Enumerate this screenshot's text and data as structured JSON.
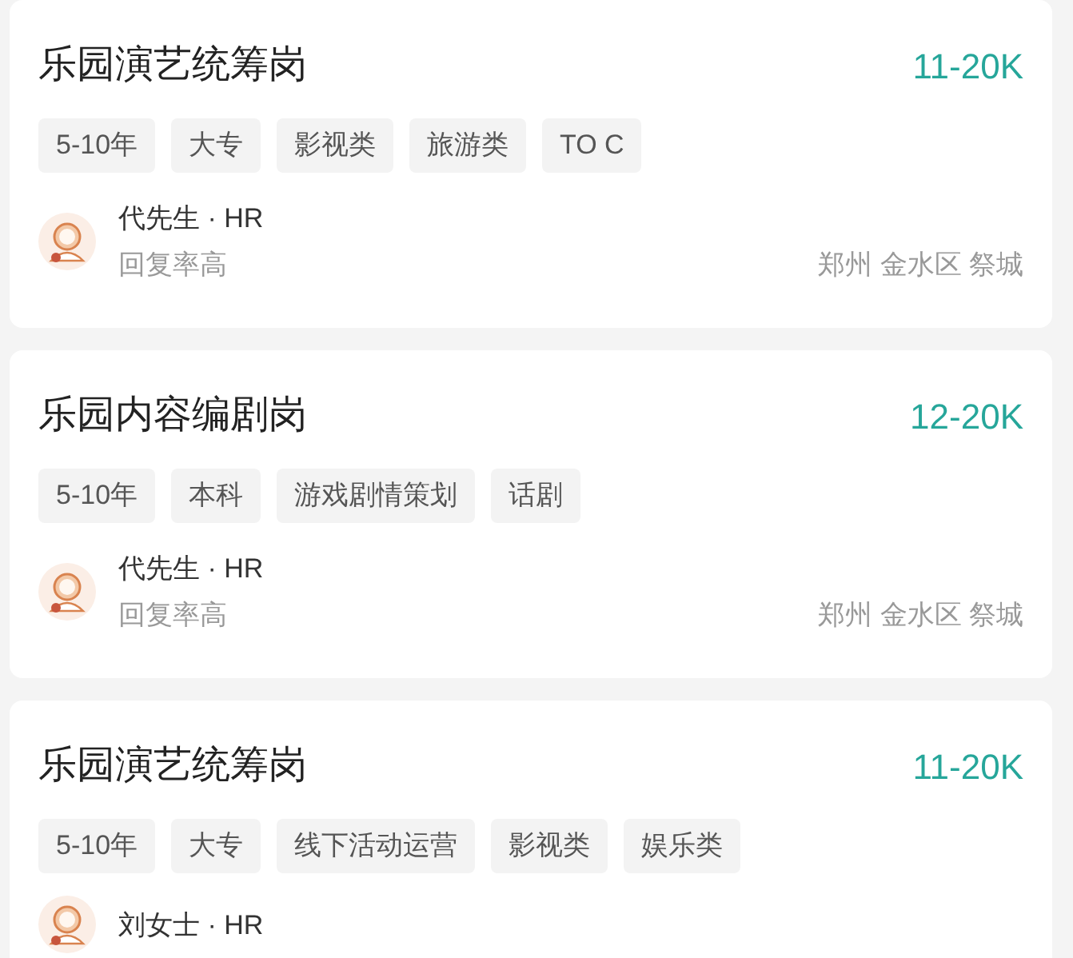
{
  "jobs": [
    {
      "title": "乐园演艺统筹岗",
      "salary": "11-20K",
      "tags": [
        "5-10年",
        "大专",
        "影视类",
        "旅游类",
        "TO C"
      ],
      "recruiter": "代先生 · HR",
      "reply": "回复率高",
      "location": "郑州 金水区 祭城"
    },
    {
      "title": "乐园内容编剧岗",
      "salary": "12-20K",
      "tags": [
        "5-10年",
        "本科",
        "游戏剧情策划",
        "话剧"
      ],
      "recruiter": "代先生 · HR",
      "reply": "回复率高",
      "location": "郑州 金水区 祭城"
    },
    {
      "title": "乐园演艺统筹岗",
      "salary": "11-20K",
      "tags": [
        "5-10年",
        "大专",
        "线下活动运营",
        "影视类",
        "娱乐类"
      ],
      "recruiter": "刘女士 · HR"
    }
  ]
}
